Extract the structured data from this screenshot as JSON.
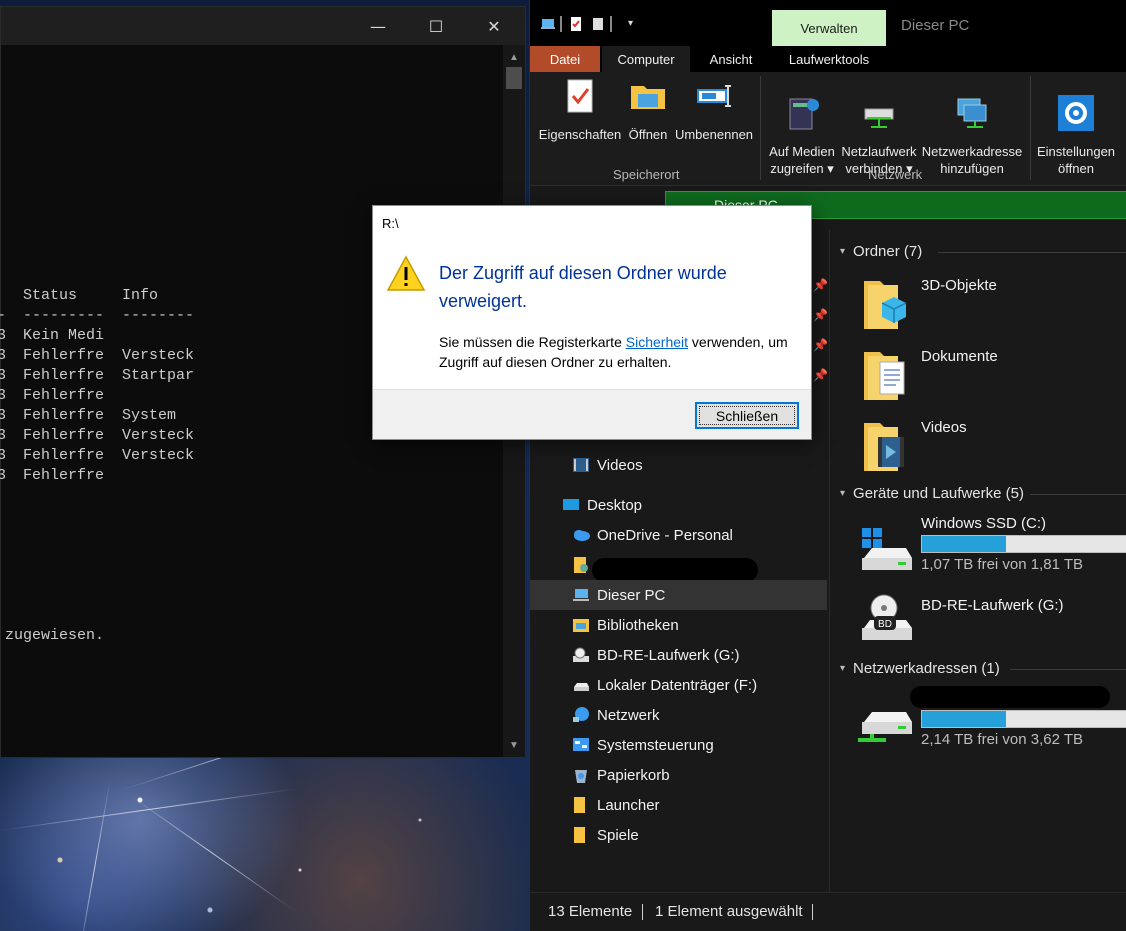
{
  "console": {
    "title_buttons": {
      "minimize": "—",
      "maximize": "☐",
      "close": "✕"
    },
    "header_status": "Status",
    "header_info": "Info",
    "header_dash_left": "-",
    "header_dash_status": "---------",
    "header_dash_info": "--------",
    "rows": [
      {
        "prefix": "3",
        "status": "Kein Medi",
        "info": ""
      },
      {
        "prefix": "3",
        "status": "Fehlerfre",
        "info": "Versteck"
      },
      {
        "prefix": "3",
        "status": "Fehlerfre",
        "info": "Startpar"
      },
      {
        "prefix": "3",
        "status": "Fehlerfre",
        "info": ""
      },
      {
        "prefix": "3",
        "status": "Fehlerfre",
        "info": "System"
      },
      {
        "prefix": "3",
        "status": "Fehlerfre",
        "info": "Versteck"
      },
      {
        "prefix": "3",
        "status": "Fehlerfre",
        "info": "Versteck"
      },
      {
        "prefix": "3",
        "status": "Fehlerfre",
        "info": ""
      }
    ],
    "footer_line": "zugewiesen."
  },
  "explorer": {
    "manage_tab": "Verwalten",
    "window_title": "Dieser PC",
    "tabs": [
      "Datei",
      "Computer",
      "Ansicht",
      "Laufwerktools"
    ],
    "ribbon": {
      "buttons": [
        {
          "label": "Eigenschaften",
          "icon": "properties-icon"
        },
        {
          "label": "Öffnen",
          "icon": "open-folder-icon"
        },
        {
          "label": "Umbenennen",
          "icon": "rename-icon"
        },
        {
          "label": "Auf Medien\nzugreifen ▾",
          "icon": "media-icon"
        },
        {
          "label": "Netzlaufwerk\nverbinden ▾",
          "icon": "network-drive-icon"
        },
        {
          "label": "Netzwerkadresse\nhinzufügen",
          "icon": "network-location-icon"
        },
        {
          "label": "Einstellungen\nöffnen",
          "icon": "settings-gear-icon"
        }
      ],
      "groups": [
        "Speicherort",
        "Netzwerk"
      ]
    },
    "address": "Dieser PC",
    "nav": [
      {
        "label": "Videos",
        "icon": "videos-icon"
      },
      {
        "label": "Desktop",
        "icon": "desktop-icon"
      },
      {
        "label": "OneDrive - Personal",
        "icon": "onedrive-icon"
      },
      {
        "label": "",
        "icon": "user-folder-icon"
      },
      {
        "label": "Dieser PC",
        "icon": "this-pc-icon"
      },
      {
        "label": "Bibliotheken",
        "icon": "libraries-icon"
      },
      {
        "label": "BD-RE-Laufwerk (G:)",
        "icon": "optical-drive-icon"
      },
      {
        "label": "Lokaler Datenträger (F:)",
        "icon": "local-drive-icon"
      },
      {
        "label": "Netzwerk",
        "icon": "network-icon"
      },
      {
        "label": "Systemsteuerung",
        "icon": "control-panel-icon"
      },
      {
        "label": "Papierkorb",
        "icon": "recycle-bin-icon"
      },
      {
        "label": "Launcher",
        "icon": "folder-icon"
      },
      {
        "label": "Spiele",
        "icon": "folder-icon"
      }
    ],
    "sections": {
      "folders": "Ordner (7)",
      "devices": "Geräte und Laufwerke (5)",
      "network": "Netzwerkadressen (1)"
    },
    "folders": [
      {
        "name": "3D-Objekte",
        "icon": "3d-objects-folder-icon"
      },
      {
        "name": "Dokumente",
        "icon": "documents-folder-icon"
      },
      {
        "name": "Videos",
        "icon": "videos-folder-icon"
      }
    ],
    "drives": [
      {
        "name": "Windows SSD (C:)",
        "free": "1,07 TB frei von 1,81 TB",
        "used_fraction": 0.41
      },
      {
        "name": "BD-RE-Laufwerk (G:)",
        "free": "",
        "used_fraction": null
      }
    ],
    "network_drive": {
      "name": "",
      "free": "2,14 TB frei von 3,62 TB",
      "used_fraction": 0.41
    },
    "status": {
      "count": "13 Elemente",
      "selection": "1 Element ausgewählt"
    }
  },
  "dialog": {
    "title": "R:\\",
    "heading": "Der Zugriff auf diesen Ordner wurde verweigert.",
    "msg_before": "Sie müssen die Registerkarte ",
    "msg_link": "Sicherheit",
    "msg_after": " verwenden, um Zugriff auf diesen Ordner zu erhalten.",
    "close_button": "Schließen"
  },
  "colors": {
    "accent": "#0078d7",
    "file_tab": "#b24b2a",
    "manage_tab": "#cef2c3",
    "address_bar": "#0e6b1e",
    "progress": "#26a0da",
    "heading_blue": "#003399"
  }
}
